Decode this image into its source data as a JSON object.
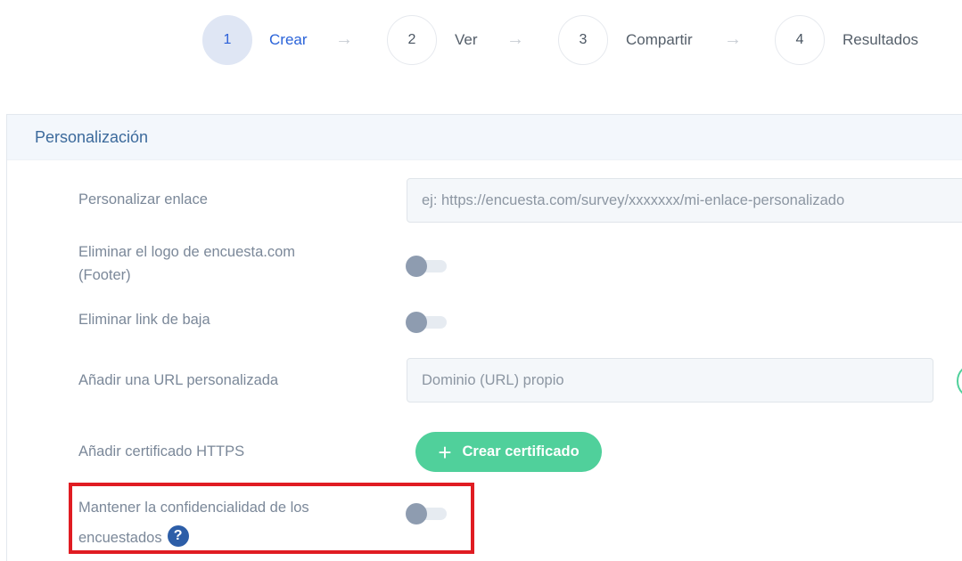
{
  "stepper": {
    "steps": [
      {
        "number": "1",
        "label": "Crear",
        "active": true
      },
      {
        "number": "2",
        "label": "Ver",
        "active": false
      },
      {
        "number": "3",
        "label": "Compartir",
        "active": false
      },
      {
        "number": "4",
        "label": "Resultados",
        "active": false
      }
    ],
    "arrow_glyph": "→"
  },
  "panel": {
    "title": "Personalización",
    "custom_link": {
      "label": "Personalizar enlace",
      "placeholder": "ej: https://encuesta.com/survey/xxxxxxx/mi-enlace-personalizado"
    },
    "remove_logo": {
      "label_line1": "Eliminar el logo de encuesta.com",
      "label_line2": "(Footer)",
      "enabled": false
    },
    "remove_unsubscribe": {
      "label": "Eliminar link de baja",
      "enabled": false
    },
    "custom_url": {
      "label": "Añadir una URL personalizada",
      "placeholder": "Dominio (URL) propio"
    },
    "https_cert": {
      "label": "Añadir certificado HTTPS",
      "button_icon": "+",
      "button_label": "Crear certificado"
    },
    "confidentiality": {
      "label_line1": "Mantener la confidencialidad de los",
      "label_line2": "encuestados",
      "help_glyph": "?",
      "enabled": false
    }
  },
  "colors": {
    "accent_blue": "#2a63d9",
    "green": "#50d09b",
    "highlight_red": "#e01c22",
    "toggle_off": "#8e9cb0"
  }
}
